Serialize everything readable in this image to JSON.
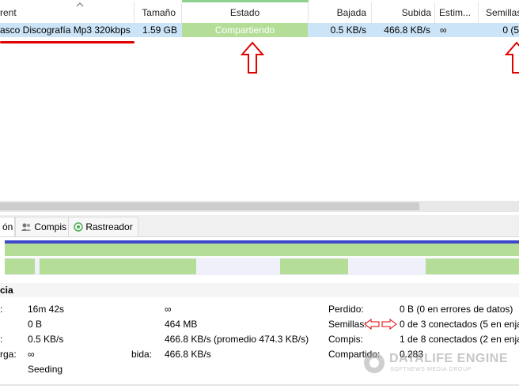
{
  "columns": {
    "torrent": "rent",
    "size": "Tamaño",
    "state": "Estado",
    "down": "Bajada",
    "up": "Subida",
    "eta": "Estim...",
    "seeds": "Semillas"
  },
  "row": {
    "name": "asco Discografía Mp3 320kbps",
    "size": "1.59 GB",
    "state": "Compartiendo",
    "down": "0.5 KB/s",
    "up": "466.8 KB/s",
    "eta": "∞",
    "seeds": "0 (5"
  },
  "tabs": {
    "info": "ón",
    "peers": "Compis",
    "trackers": "Rastreador"
  },
  "section": {
    "title": "cia"
  },
  "info": {
    "col1": [
      {
        "label": ":",
        "value": "16m 42s"
      },
      {
        "label": "",
        "value": "0 B"
      },
      {
        "label": ":",
        "value": "0.5 KB/s"
      },
      {
        "label": "rga:",
        "value": "∞"
      },
      {
        "label": "",
        "value": "Seeding"
      }
    ],
    "col2": [
      {
        "label": "",
        "value": "∞"
      },
      {
        "label": "",
        "value": "464 MB"
      },
      {
        "label": "",
        "value": "466.8 KB/s (promedio 474.3 KB/s)"
      },
      {
        "label": "bida:",
        "value": "466.8 KB/s"
      }
    ],
    "col3": [
      {
        "label": "Perdido:",
        "value": "0 B (0 en errores de datos)"
      },
      {
        "label": "Semillas:",
        "value": "0 de 3 conectados (5 en enjam"
      },
      {
        "label": "Compis:",
        "value": "1 de 8 conectados (2 en enjam"
      },
      {
        "label": "Compartido:",
        "value": "0.283"
      }
    ]
  },
  "watermark": {
    "title": "DATALIFE ENGINE",
    "subtitle": "SOFTNEWS MEDIA GROUP"
  },
  "colors": {
    "accent_red": "#e00000",
    "progress_green": "#b4dd98",
    "selection_blue": "#cce4f7",
    "bar_blue": "#3f48cc"
  }
}
